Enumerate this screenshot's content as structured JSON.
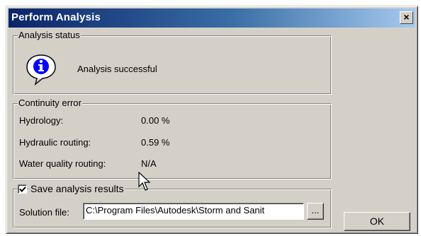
{
  "window": {
    "title": "Perform Analysis",
    "close_glyph": "×"
  },
  "analysis_status": {
    "legend": "Analysis status",
    "icon": "info-icon",
    "message": "Analysis successful"
  },
  "continuity_error": {
    "legend": "Continuity error",
    "rows": [
      {
        "label": "Hydrology:",
        "value": "0.00 %"
      },
      {
        "label": "Hydraulic routing:",
        "value": "0.59 %"
      },
      {
        "label": "Water quality routing:",
        "value": "N/A"
      }
    ]
  },
  "save_results": {
    "checkbox_label": "Save analysis results",
    "checked": true,
    "solution_label": "Solution file:",
    "solution_value": "C:\\Program Files\\Autodesk\\Storm and Sanit",
    "browse_label": "..."
  },
  "ok_button": {
    "label": "OK"
  },
  "colors": {
    "face": "#d4d0c8",
    "title_start": "#0a246a",
    "title_end": "#a6caf0"
  }
}
